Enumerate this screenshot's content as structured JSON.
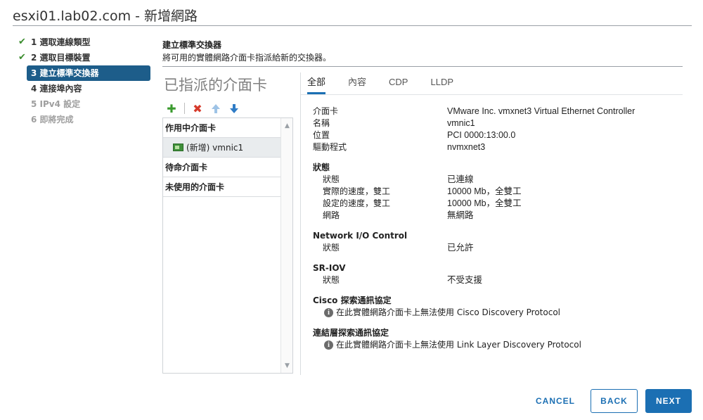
{
  "window": {
    "title": "esxi01.lab02.com - 新增網路"
  },
  "steps": [
    {
      "label": "1 選取連線類型",
      "state": "done"
    },
    {
      "label": "2 選取目標裝置",
      "state": "done"
    },
    {
      "label": "3 建立標準交換器",
      "state": "active"
    },
    {
      "label": "4 連接埠內容",
      "state": "pending"
    },
    {
      "label": "5 IPv4 設定",
      "state": "disabled"
    },
    {
      "label": "6 即將完成",
      "state": "disabled"
    }
  ],
  "section": {
    "title": "建立標準交換器",
    "description": "將可用的實體網路介面卡指派給新的交換器。"
  },
  "assigned": {
    "heading": "已指派的介面卡",
    "groups": {
      "active": "作用中介面卡",
      "standby": "待命介面卡",
      "unused": "未使用的介面卡"
    },
    "active_adapters": [
      {
        "label": "(新增) vmnic1"
      }
    ]
  },
  "tabs": [
    {
      "label": "全部",
      "active": true
    },
    {
      "label": "內容",
      "active": false
    },
    {
      "label": "CDP",
      "active": false
    },
    {
      "label": "LLDP",
      "active": false
    }
  ],
  "details": {
    "adapter": {
      "k": "介面卡",
      "v": "VMware Inc. vmxnet3 Virtual Ethernet Controller"
    },
    "name": {
      "k": "名稱",
      "v": "vmnic1"
    },
    "location": {
      "k": "位置",
      "v": "PCI 0000:13:00.0"
    },
    "driver": {
      "k": "驅動程式",
      "v": "nvmxnet3"
    },
    "status_heading": "狀態",
    "status": {
      "k": "狀態",
      "v": "已連線"
    },
    "actual_speed": {
      "k": "實際的速度，雙工",
      "v": "10000 Mb，全雙工"
    },
    "configured_speed": {
      "k": "設定的速度，雙工",
      "v": "10000 Mb，全雙工"
    },
    "networks": {
      "k": "網路",
      "v": "無網路"
    },
    "nioc_heading": "Network I/O Control",
    "nioc_status": {
      "k": "狀態",
      "v": "已允許"
    },
    "sriov_heading": "SR-IOV",
    "sriov_status": {
      "k": "狀態",
      "v": "不受支援"
    },
    "cdp_heading": "Cisco 探索通訊協定",
    "cdp_info": "在此實體網路介面卡上無法使用 Cisco Discovery Protocol",
    "lldp_heading": "連結層探索通訊協定",
    "lldp_info": "在此實體網路介面卡上無法使用 Link Layer Discovery Protocol"
  },
  "footer": {
    "cancel": "CANCEL",
    "back": "BACK",
    "next": "NEXT"
  },
  "colors": {
    "accent": "#1b6fb3",
    "active_step": "#1d5d8a",
    "check": "#3c8d2f"
  }
}
